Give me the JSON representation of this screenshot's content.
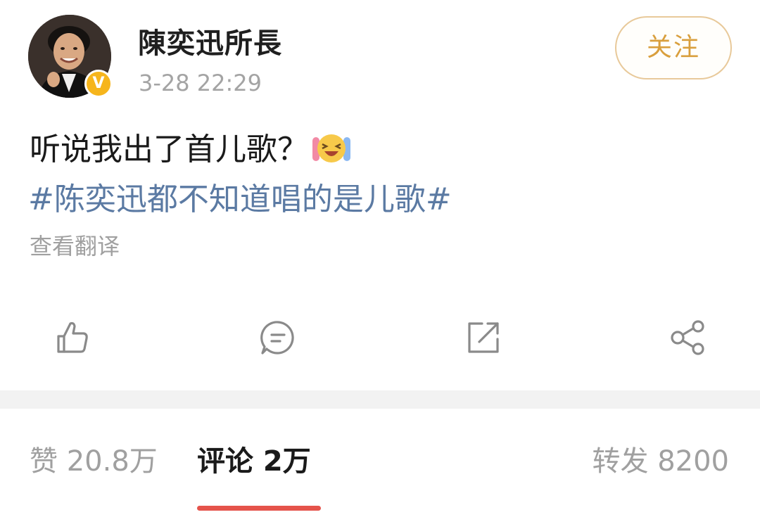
{
  "user": {
    "name": "陳奕迅所長",
    "timestamp": "3-28 22:29",
    "verified_mark": "V",
    "avatar": "avatar-photo"
  },
  "follow_button": {
    "label": "关注"
  },
  "post": {
    "text": "听说我出了首儿歌？",
    "emoji": "laugh-cry-emoji",
    "hashtag": "#陈奕迅都不知道唱的是儿歌#",
    "translate_label": "查看翻译"
  },
  "actions": {
    "icons": [
      "like-icon",
      "comment-icon",
      "repost-icon",
      "share-icon"
    ]
  },
  "tabs": {
    "likes": "赞 20.8万",
    "comments": "评论 2万",
    "reposts": "转发 8200"
  },
  "colors": {
    "hashtag": "#5b7aa3",
    "follow_text": "#d99f3d",
    "follow_border": "#e8c99a",
    "verified_badge": "#f6b51c",
    "tab_underline": "#e5534b",
    "muted_text": "#a0a0a0"
  }
}
